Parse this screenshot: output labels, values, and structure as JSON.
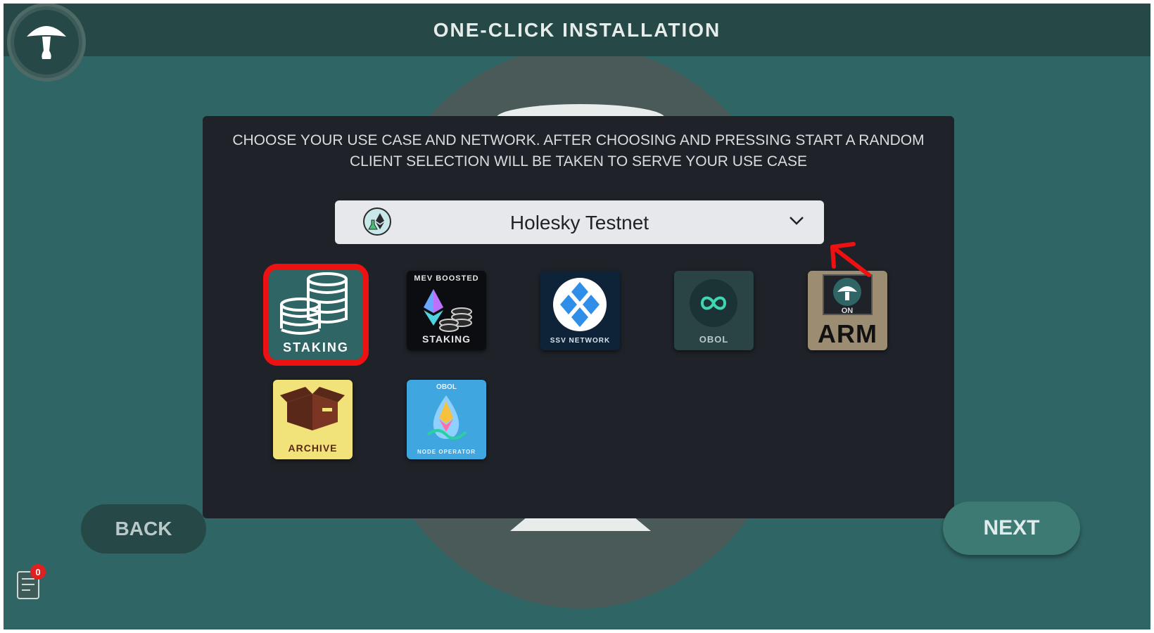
{
  "header": {
    "title": "ONE-CLICK INSTALLATION",
    "logo_icon": "mushroom-logo-icon"
  },
  "panel": {
    "instruction": "CHOOSE YOUR USE CASE AND NETWORK. AFTER CHOOSING AND PRESSING START A RANDOM CLIENT SELECTION WILL BE TAKEN TO SERVE YOUR USE CASE",
    "network_select": {
      "value": "Holesky Testnet",
      "icon": "ethereum-testnet-flask-icon"
    },
    "use_cases": [
      {
        "id": "staking",
        "label": "STAKING",
        "icon": "coin-stack-icon",
        "selected": true
      },
      {
        "id": "mev",
        "top_label": "MEV BOOSTED",
        "label": "STAKING",
        "icon": "ethereum-coins-icon"
      },
      {
        "id": "ssv",
        "label": "SSV NETWORK",
        "icon": "ssv-logo-icon"
      },
      {
        "id": "obol",
        "label": "OBOL",
        "icon": "obol-loop-icon"
      },
      {
        "id": "arm",
        "small_label": "ON",
        "label": "ARM",
        "icon": "mushroom-chip-icon"
      },
      {
        "id": "archive",
        "label": "ARCHIVE",
        "icon": "box-icon"
      },
      {
        "id": "obol-node",
        "top_label": "OBOL",
        "label": "NODE OPERATOR",
        "icon": "drop-icon"
      }
    ]
  },
  "footer": {
    "back_label": "BACK",
    "next_label": "NEXT",
    "notifications_count": "0"
  },
  "colors": {
    "background": "#2f6564",
    "header": "#264846",
    "panel": "#1f2329",
    "selection_highlight": "#ee1111",
    "annotation_arrow": "#ee1111"
  }
}
